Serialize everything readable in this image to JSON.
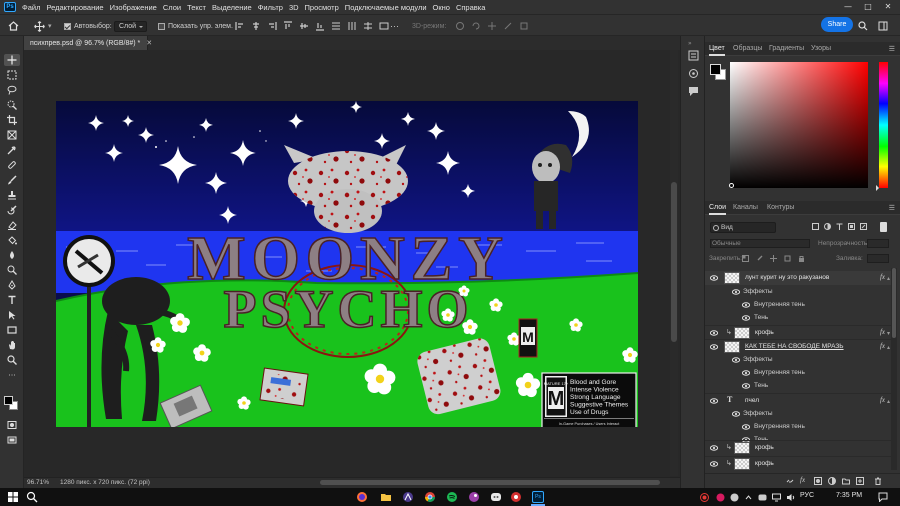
{
  "app": {
    "logo_text": "Ps"
  },
  "menu": [
    "Файл",
    "Редактирование",
    "Изображение",
    "Слои",
    "Текст",
    "Выделение",
    "Фильтр",
    "3D",
    "Просмотр",
    "Подключаемые модули",
    "Окно",
    "Справка"
  ],
  "options_bar": {
    "autoselect_label": "Автовыбор:",
    "autoselect_checked": true,
    "autoselect_target": "Слой",
    "show_transform_label": "Показать упр. элем.",
    "show_transform_checked": false,
    "mode_3d_label": "3D-режим:",
    "share_label": "Share"
  },
  "document": {
    "tab_title": "психпрев.psd @ 96.7% (RGB/8#) *",
    "zoom": "96.71%",
    "info": "1280 пикс. x 720 пикс. (72 ppi)"
  },
  "color_panel": {
    "tabs": [
      "Цвет",
      "Образцы",
      "Градиенты",
      "Узоры"
    ],
    "active_tab": "Цвет",
    "foreground": "#000000",
    "background": "#ffffff",
    "hue": "#ff0000"
  },
  "layers_panel": {
    "tabs": [
      "Слои",
      "Каналы",
      "Контуры"
    ],
    "active_tab": "Слои",
    "filter_kind": "Вид",
    "blend_mode": "Обычные",
    "opacity_label": "Непрозрачность:",
    "lock_label": "Закрепить:",
    "fill_label": "Заливка:",
    "layers": [
      {
        "type": "raster",
        "name": "лунт курит ну это ракузанов",
        "visible": true,
        "has_fx": true,
        "effects_label": "Эффекты",
        "effects": [
          "Внутренняя тень",
          "Тень"
        ]
      },
      {
        "type": "raster",
        "name": "крофь",
        "visible": true,
        "has_fx": true,
        "linked": true
      },
      {
        "type": "raster",
        "name": "КАК ТЕБЕ НА СВОБОДЕ МРАЗЬ",
        "visible": true,
        "has_fx": true,
        "underline": true,
        "effects_label": "Эффекты",
        "effects": [
          "Внутренняя тень",
          "Тень"
        ]
      },
      {
        "type": "text",
        "name": "пчел",
        "visible": true,
        "has_fx": true,
        "effects_label": "Эффекты",
        "effects": [
          "Внутренняя тень",
          "Тень"
        ]
      },
      {
        "type": "raster",
        "name": "крофь",
        "visible": true,
        "has_fx": false,
        "linked": true
      },
      {
        "type": "raster",
        "name": "крофь",
        "visible": true,
        "has_fx": false,
        "linked": true
      }
    ]
  },
  "artwork": {
    "title_line1": "MOONZY",
    "title_line2": "PSYCHO",
    "rating_box": {
      "rating": "M",
      "rating_word": "MATURE 17+",
      "descriptors": [
        "Blood and Gore",
        "Intense Violence",
        "Strong Language",
        "Suggestive Themes",
        "Use of Drugs"
      ],
      "footer": "In-Game Purchases / Users Interact"
    },
    "colors": {
      "sky": "#0a0d4e",
      "sea": "#1f35f0",
      "grass": "#19c21c",
      "title": "#8d7f84"
    }
  },
  "taskbar": {
    "language": "РУС",
    "time": "7:35 PM"
  }
}
